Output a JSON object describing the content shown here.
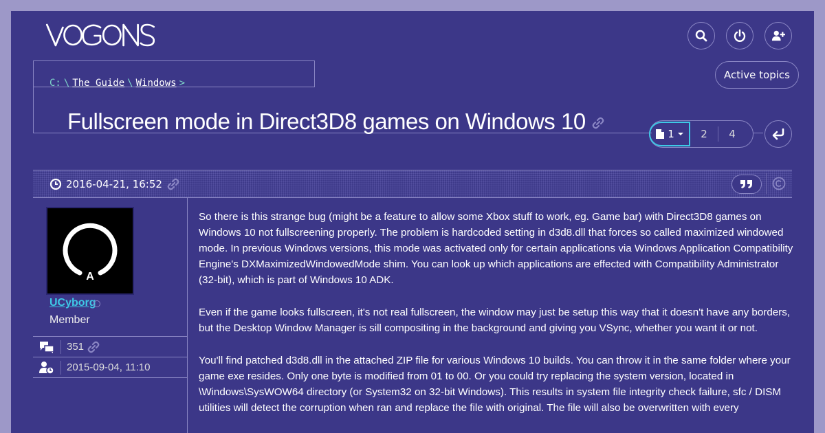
{
  "site": {
    "logo_text": "VOGONS"
  },
  "header": {
    "search_icon": "search-icon",
    "login_icon": "power-icon",
    "register_icon": "add-user-icon",
    "active_topics_label": "Active topics"
  },
  "breadcrumb": {
    "drive": "C:",
    "sep": "\\",
    "items": [
      "The Guide",
      "Windows"
    ],
    "end": ">"
  },
  "topic": {
    "title": "Fullscreen mode in Direct3D8 games on Windows 10",
    "pagination": {
      "current": "1",
      "pages": [
        "2",
        "4"
      ]
    }
  },
  "post": {
    "date": "2016-04-21, 16:52",
    "author": {
      "name": "UCyborg",
      "role": "Member",
      "posts": "351",
      "joined": "2015-09-04, 11:10",
      "avatar_letter": "A"
    },
    "paragraphs": [
      "So there is this strange bug (might be a feature to allow some Xbox stuff to work, eg. Game bar) with Direct3D8 games on Windows 10 not fullscreening properly. The problem is hardcoded setting in d3d8.dll that forces so called maximized windowed mode. In previous Windows versions, this mode was activated only for certain applications via Windows Application Compatibility Engine's DXMaximizedWindowedMode shim. You can look up which applications are effected with Compatibility Administrator (32-bit), which is part of Windows 10 ADK.",
      "Even if the game looks fullscreen, it's not real fullscreen, the window may just be setup this way that it doesn't have any borders, but the Desktop Window Manager is sill compositing in the background and giving you VSync, whether you want it or not.",
      "You'll find patched d3d8.dll in the attached ZIP file for various Windows 10 builds. You can throw it in the same folder where your game exe resides. Only one byte is modified from 01 to 00. Or you could try replacing the system version, located in \\Windows\\SysWOW64 directory (or System32 on 32-bit Windows). This results in system file integrity check failure, sfc / DISM utilities will detect the corruption when ran and replace the file with original. The file will also be overwritten with every"
    ]
  },
  "colors": {
    "background": "#3c3788",
    "outer": "#9d98c8",
    "accent": "#3ec9e6",
    "border": "#8a86c4"
  }
}
